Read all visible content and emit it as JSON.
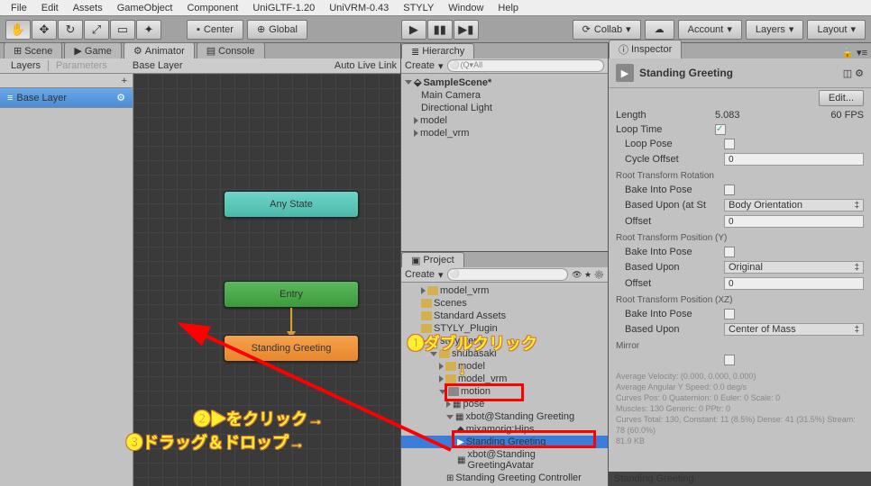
{
  "menu": [
    "File",
    "Edit",
    "Assets",
    "GameObject",
    "Component",
    "UniGLTF-1.20",
    "UniVRM-0.43",
    "STYLY",
    "Window",
    "Help"
  ],
  "toolbar": {
    "center": "Center",
    "global": "Global",
    "collab": "Collab",
    "account": "Account",
    "layers": "Layers",
    "layout": "Layout"
  },
  "left_panels": {
    "scene": "Scene",
    "game": "Game",
    "animator": "Animator",
    "console": "Console"
  },
  "layers_tab": "Layers",
  "params_tab": "Parameters",
  "base_layer": "Base Layer",
  "autolive": "Auto Live Link",
  "layer_item": "Base Layer",
  "plus": "+",
  "nodes": {
    "any": "Any State",
    "entry": "Entry",
    "state": "Standing Greeting"
  },
  "hier": {
    "title": "Hierarchy",
    "create": "Create",
    "search": "All",
    "scene": "SampleScene*",
    "items": [
      "Main Camera",
      "Directional Light",
      "model",
      "model_vrm"
    ]
  },
  "proj": {
    "title": "Project",
    "create": "Create",
    "items": [
      "model_vrm",
      "Scenes",
      "Standard Assets",
      "STYLY_Plugin",
      "styly_temp",
      "shubasaki",
      "model",
      "model_vrm",
      "motion",
      "pose",
      "xbot@Standing Greeting",
      "mixamorig:Hips",
      "Standing Greeting",
      "xbot@Standing GreetingAvatar",
      "Standing Greeting Controller"
    ]
  },
  "insp": {
    "title": "Inspector",
    "name": "Standing Greeting",
    "edit": "Edit...",
    "length_l": "Length",
    "length_v": "5.083",
    "fps": "60 FPS",
    "loop_time": "Loop Time",
    "loop_pose": "Loop Pose",
    "cycle": "Cycle Offset",
    "cycle_v": "0",
    "rtr": "Root Transform Rotation",
    "bip": "Bake Into Pose",
    "based": "Based Upon (at St",
    "based_v": "Body Orientation",
    "offset": "Offset",
    "offset_v": "0",
    "rty": "Root Transform Position (Y)",
    "based2": "Based Upon",
    "based2_v": "Original",
    "rtxz": "Root Transform Position (XZ)",
    "based3_v": "Center of Mass",
    "mirror": "Mirror",
    "stats": "Average Velocity: (0.000, 0.000, 0.000)\nAverage Angular Y Speed: 0.0 deg/s\nCurves Pos: 0 Quaternion: 0 Euler: 0 Scale: 0\nMuscles: 130 Generic: 0 PPtr: 0\nCurves Total: 130, Constant: 11 (8.5%) Dense: 41 (31.5%) Stream: 78 (60.0%)\n81.9 KB",
    "footer": "Standing Greeting"
  },
  "annot": {
    "a1": "❶ダブルクリック",
    "a2": "❷▶をクリック→",
    "a3": "❸ドラッグ＆ドロップ→",
    "down": "↓"
  }
}
